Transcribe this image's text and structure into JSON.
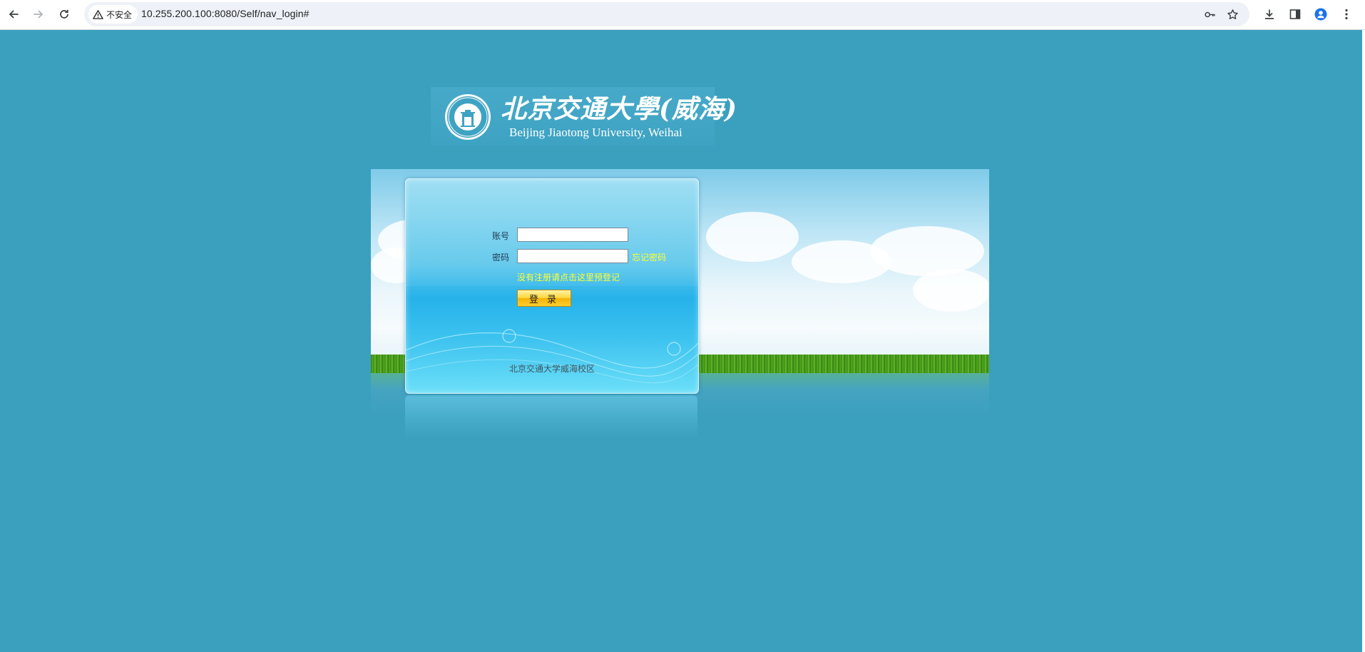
{
  "browser": {
    "security_label": "不安全",
    "url": "10.255.200.100:8080/Self/nav_login#"
  },
  "logo": {
    "name_cn": "北京交通大學(威海)",
    "name_en": "Beijing Jiaotong University, Weihai"
  },
  "login": {
    "account_label": "账号",
    "account_value": "",
    "password_label": "密码",
    "password_value": "",
    "forgot_password": "忘记密码",
    "register_hint": "没有注册请点击这里预登记",
    "login_button": "登 录",
    "footer": "北京交通大学威海校区"
  },
  "colors": {
    "page_background": "#3aa0be",
    "link_yellow": "#ffff33",
    "button_gold": "#ffd53a"
  }
}
